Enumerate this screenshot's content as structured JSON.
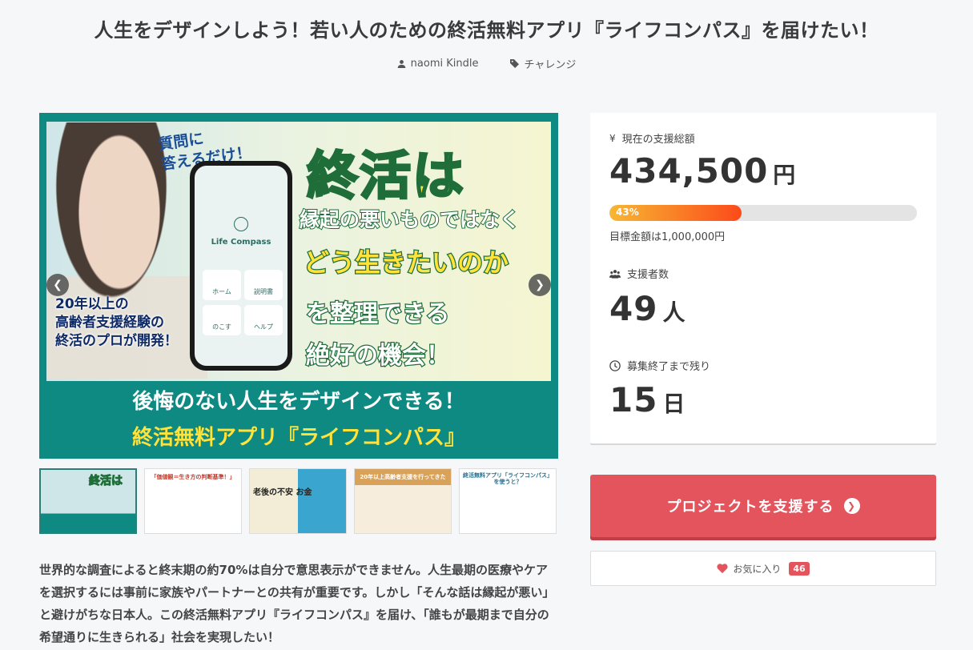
{
  "project": {
    "title": "人生をデザインしよう！若い人のための終活無料アプリ『ライフコンパス』を届けたい！",
    "author": "naomi Kindle",
    "category": "チャレンジ"
  },
  "hero": {
    "question": "質問に\n答えるだけ！",
    "app_name": "Life Compass",
    "app_buttons": [
      "ホーム",
      "説明書",
      "のこす",
      "ヘルプ"
    ],
    "headline": "終活は",
    "line2": "縁起の悪いものではなく",
    "line3": "どう生きたいのか",
    "line4": "を整理できる",
    "line5": "絶好の機会！",
    "expert": "20年以上の\n高齢者支援経験の\n終活のプロが開発！",
    "band1": "後悔のない人生をデザインできる！",
    "band2": "終活無料アプリ『ライフコンパス』",
    "prev_icon": "chevron-left-icon",
    "next_icon": "chevron-right-icon"
  },
  "thumbnails": [
    {
      "text": "終活は"
    },
    {
      "text": "「価値観＝生き方の判断基準！」"
    },
    {
      "text": "老後の不安 お金"
    },
    {
      "text": "20年以上高齢者支援を行ってきた"
    },
    {
      "text": "終活無料アプリ「ライフコンパス」を使うと？"
    }
  ],
  "description": "世界的な調査によると終末期の約70%は自分で意思表示ができません。人生最期の医療やケアを選択するには事前に家族やパートナーとの共有が重要です。しかし「そんな話は縁起が悪い」と避けがちな日本人。この終活無料アプリ『ライフコンパス』を届け、「誰もが最期まで自分の希望通りに生きられる」社会を実現したい！",
  "stats": {
    "total_label": "現在の支援総額",
    "total_icon": "yen-icon",
    "total_value": "434,500",
    "total_unit": "円",
    "progress_label": "43%",
    "progress_fraction": 0.43,
    "goal": "目標金額は1,000,000円",
    "backers_label": "支援者数",
    "backers_value": "49",
    "backers_unit": "人",
    "remaining_label": "募集終了まで残り",
    "remaining_value": "15",
    "remaining_unit": "日"
  },
  "actions": {
    "support_label": "プロジェクトを支援する",
    "favorite_label": "お気に入り",
    "favorite_count": "46"
  },
  "colors": {
    "accent": "#e3545d",
    "teal": "#0e8a83"
  }
}
